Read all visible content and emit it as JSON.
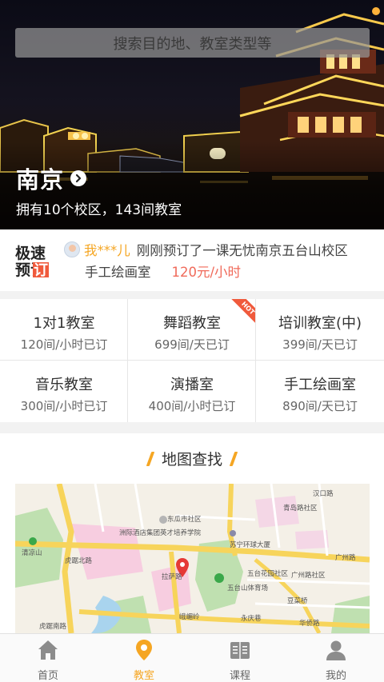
{
  "search": {
    "placeholder": "搜索目的地、教室类型等"
  },
  "city": {
    "name": "南京",
    "summary": "拥有10个校区，143间教室"
  },
  "notice": {
    "logo_top": "极速",
    "logo_bottom": "预订",
    "user": "我***儿",
    "text": "刚刚预订了一课无忧南京五台山校区",
    "room": "手工绘画室",
    "price": "120元/小时"
  },
  "categories": [
    {
      "title": "1对1教室",
      "sub": "120间/小时已订"
    },
    {
      "title": "舞蹈教室",
      "sub": "699间/天已订",
      "badge": "HOT"
    },
    {
      "title": "培训教室(中)",
      "sub": "399间/天已订"
    },
    {
      "title": "音乐教室",
      "sub": "300间/小时已订"
    },
    {
      "title": "演播室",
      "sub": "400间/小时已订"
    },
    {
      "title": "手工绘画室",
      "sub": "890间/天已订"
    }
  ],
  "map_section": {
    "title": "地图查找"
  },
  "map_labels": {
    "l1": "东瓜市社区",
    "l2": "汉口路",
    "l3": "青岛路社区",
    "l4": "洲际酒店集团英才培养学院",
    "l5": "清凉山",
    "l6": "苏宁环球大厦",
    "l7": "广州路",
    "l8": "五台花园社区",
    "l9": "广州路社区",
    "l10": "五台山体育场",
    "l11": "拉萨路",
    "l12": "虎踞北路",
    "l13": "虎踞南路",
    "l14": "豆菜桥",
    "l15": "华侨路",
    "l16": "永庆巷",
    "l17": "峨嵋岭"
  },
  "tabs": [
    {
      "label": "首页",
      "icon": "home-icon"
    },
    {
      "label": "教室",
      "icon": "location-pin-icon",
      "active": true
    },
    {
      "label": "课程",
      "icon": "book-icon"
    },
    {
      "label": "我的",
      "icon": "person-icon"
    }
  ],
  "colors": {
    "accent": "#f5a623",
    "price": "#f06a5a",
    "hot": "#f05a3c"
  }
}
